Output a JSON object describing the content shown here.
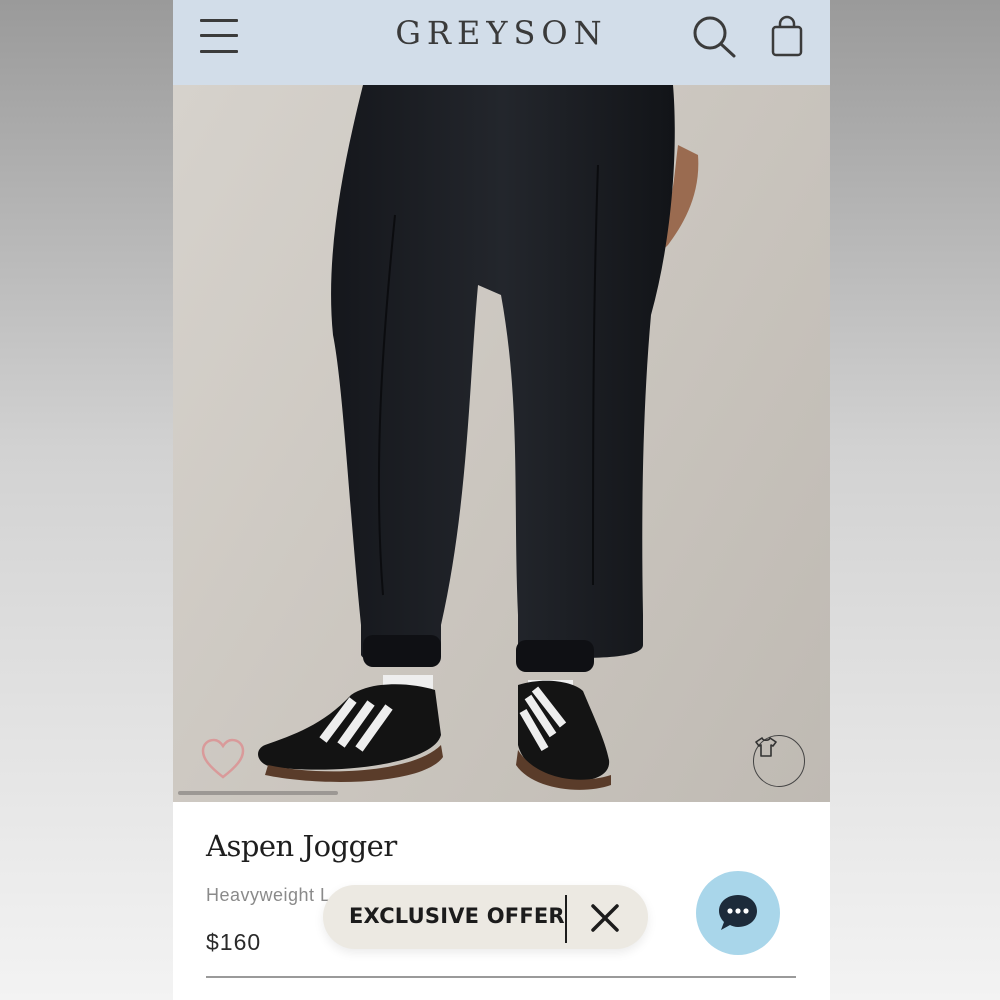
{
  "header": {
    "brand": "GREYSON",
    "menu_icon": "hamburger-menu-icon",
    "search_icon": "search-icon",
    "bag_icon": "shopping-bag-icon",
    "background_color": "#d2dde9"
  },
  "product_image": {
    "wishlist_icon": "heart-icon",
    "tryon_icon": "tshirt-icon",
    "wishlist_color": "#d99a9a"
  },
  "product": {
    "name": "Aspen Jogger",
    "subtitle_visible": "Heavyweight L",
    "price": "$160"
  },
  "offer": {
    "label": "EXCLUSIVE OFFER",
    "close_icon": "close-icon",
    "background_color": "#ece9e2"
  },
  "chat": {
    "icon": "chat-bubble-icon",
    "background_color": "#a9d6ea"
  }
}
